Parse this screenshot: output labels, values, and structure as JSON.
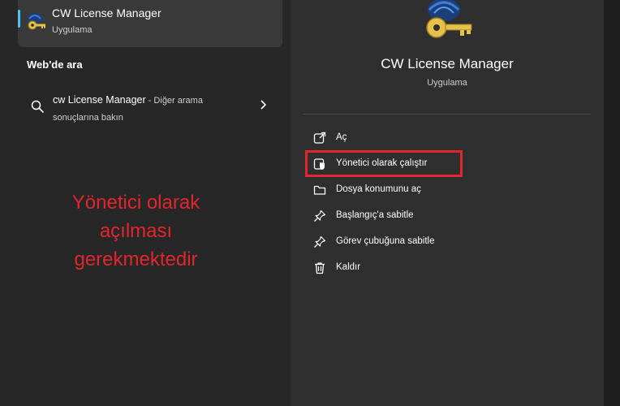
{
  "best_match": {
    "app_name": "CW License Manager",
    "app_type": "Uygulama",
    "icon": "key-app-icon"
  },
  "web_search": {
    "heading": "Web'de ara",
    "result_query": "cw License Manager",
    "result_suffix": " - Diğer arama sonuçlarına bakın"
  },
  "annotation": "Yönetici olarak\naçılması\ngerekmektedir",
  "details": {
    "app_name": "CW License Manager",
    "app_type": "Uygulama",
    "actions": [
      {
        "label": "Aç",
        "icon": "open-external-icon"
      },
      {
        "label": "Yönetici olarak çalıştır",
        "icon": "admin-shield-icon"
      },
      {
        "label": "Dosya konumunu aç",
        "icon": "folder-icon"
      },
      {
        "label": "Başlangıç'a sabitle",
        "icon": "pin-icon"
      },
      {
        "label": "Görev çubuğuna sabitle",
        "icon": "pin-icon"
      },
      {
        "label": "Kaldır",
        "icon": "trash-icon"
      }
    ]
  },
  "colors": {
    "accent": "#4cc2ff",
    "annotation_red": "#e3262d"
  }
}
